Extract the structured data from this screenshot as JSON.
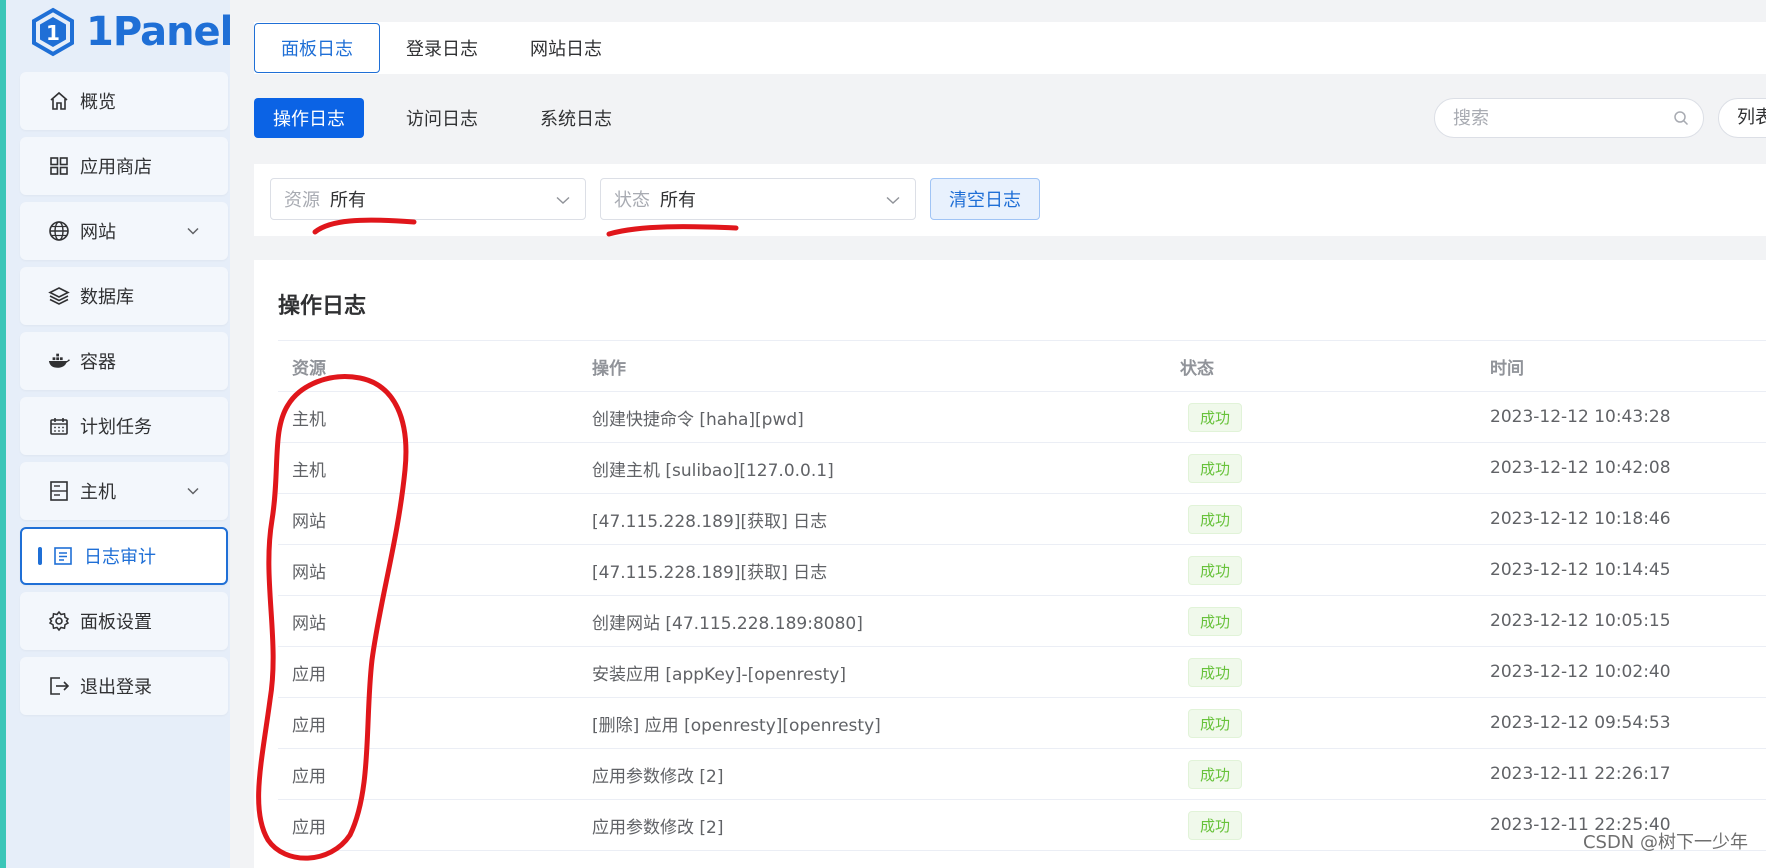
{
  "app": {
    "name": "1Panel"
  },
  "sidebar": {
    "items": [
      {
        "label": "概览",
        "icon": "home-icon"
      },
      {
        "label": "应用商店",
        "icon": "grid-icon"
      },
      {
        "label": "网站",
        "icon": "globe-icon"
      },
      {
        "label": "数据库",
        "icon": "layers-icon"
      },
      {
        "label": "容器",
        "icon": "docker-icon"
      },
      {
        "label": "计划任务",
        "icon": "calendar-icon"
      },
      {
        "label": "主机",
        "icon": "server-icon"
      },
      {
        "label": "日志审计",
        "icon": "log-icon"
      },
      {
        "label": "面板设置",
        "icon": "gear-icon"
      },
      {
        "label": "退出登录",
        "icon": "logout-icon"
      }
    ]
  },
  "top_tabs": [
    "面板日志",
    "登录日志",
    "网站日志"
  ],
  "sub_tabs": [
    "操作日志",
    "访问日志",
    "系统日志"
  ],
  "search": {
    "placeholder": "搜索"
  },
  "list_button": "列表",
  "filters": {
    "resource": {
      "label": "资源",
      "value": "所有"
    },
    "status": {
      "label": "状态",
      "value": "所有"
    },
    "clear_button": "清空日志"
  },
  "card": {
    "title": "操作日志"
  },
  "table": {
    "headers": [
      "资源",
      "操作",
      "状态",
      "时间"
    ],
    "rows": [
      {
        "resource": "主机",
        "operation": "创建快捷命令 [haha][pwd]",
        "status": "成功",
        "time": "2023-12-12 10:43:28"
      },
      {
        "resource": "主机",
        "operation": "创建主机 [sulibao][127.0.0.1]",
        "status": "成功",
        "time": "2023-12-12 10:42:08"
      },
      {
        "resource": "网站",
        "operation": "[47.115.228.189][获取] 日志",
        "status": "成功",
        "time": "2023-12-12 10:18:46"
      },
      {
        "resource": "网站",
        "operation": "[47.115.228.189][获取] 日志",
        "status": "成功",
        "time": "2023-12-12 10:14:45"
      },
      {
        "resource": "网站",
        "operation": "创建网站 [47.115.228.189:8080]",
        "status": "成功",
        "time": "2023-12-12 10:05:15"
      },
      {
        "resource": "应用",
        "operation": "安装应用 [appKey]-[openresty]",
        "status": "成功",
        "time": "2023-12-12 10:02:40"
      },
      {
        "resource": "应用",
        "operation": "[删除] 应用 [openresty][openresty]",
        "status": "成功",
        "time": "2023-12-12 09:54:53"
      },
      {
        "resource": "应用",
        "operation": "应用参数修改 [2]",
        "status": "成功",
        "time": "2023-12-11 22:26:17"
      },
      {
        "resource": "应用",
        "operation": "应用参数修改 [2]",
        "status": "成功",
        "time": "2023-12-11 22:25:40"
      }
    ]
  },
  "colors": {
    "primary": "#0b63e5",
    "success": "#67c23a",
    "annotation": "#e0161b"
  },
  "watermark": "CSDN @树下一少年"
}
